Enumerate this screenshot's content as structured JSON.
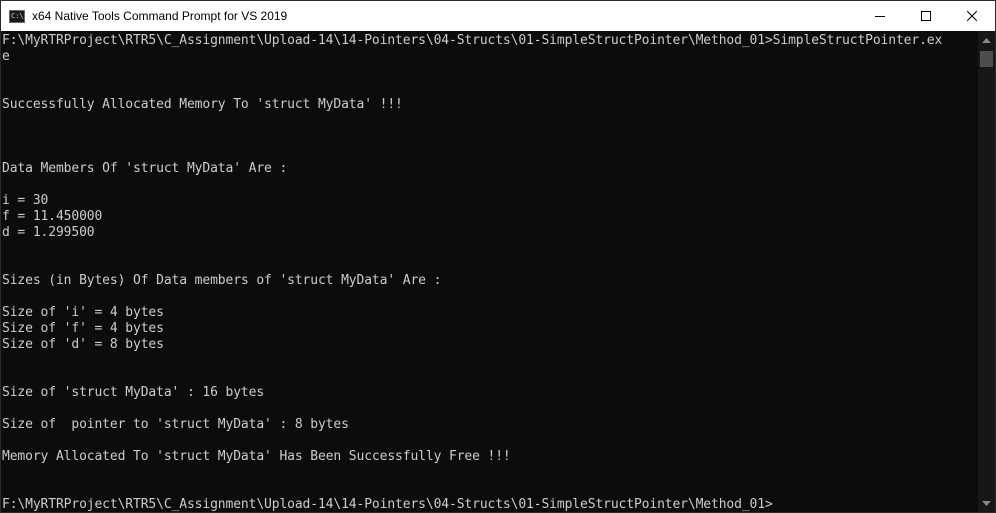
{
  "window": {
    "title": "x64 Native Tools Command Prompt for VS 2019",
    "icon": "command-prompt-icon",
    "icon_glyph": "C:\\",
    "controls": [
      "minimize-icon",
      "maximize-icon",
      "close-icon"
    ]
  },
  "console": {
    "lines": [
      "F:\\MyRTRProject\\RTR5\\C_Assignment\\Upload-14\\14-Pointers\\04-Structs\\01-SimpleStructPointer\\Method_01>SimpleStructPointer.ex",
      "e",
      "",
      "",
      "Successfully Allocated Memory To 'struct MyData' !!!",
      "",
      "",
      "",
      "Data Members Of 'struct MyData' Are :",
      "",
      "i = 30",
      "f = 11.450000",
      "d = 1.299500",
      "",
      "",
      "Sizes (in Bytes) Of Data members of 'struct MyData' Are :",
      "",
      "Size of 'i' = 4 bytes",
      "Size of 'f' = 4 bytes",
      "Size of 'd' = 8 bytes",
      "",
      "",
      "Size of 'struct MyData' : 16 bytes",
      "",
      "Size of  pointer to 'struct MyData' : 8 bytes",
      "",
      "Memory Allocated To 'struct MyData' Has Been Successfully Free !!!",
      "",
      "",
      "F:\\MyRTRProject\\RTR5\\C_Assignment\\Upload-14\\14-Pointers\\04-Structs\\01-SimpleStructPointer\\Method_01>"
    ]
  },
  "colors": {
    "background": "#0c0c0c",
    "text": "#cccccc",
    "titlebar": "#ffffff"
  }
}
